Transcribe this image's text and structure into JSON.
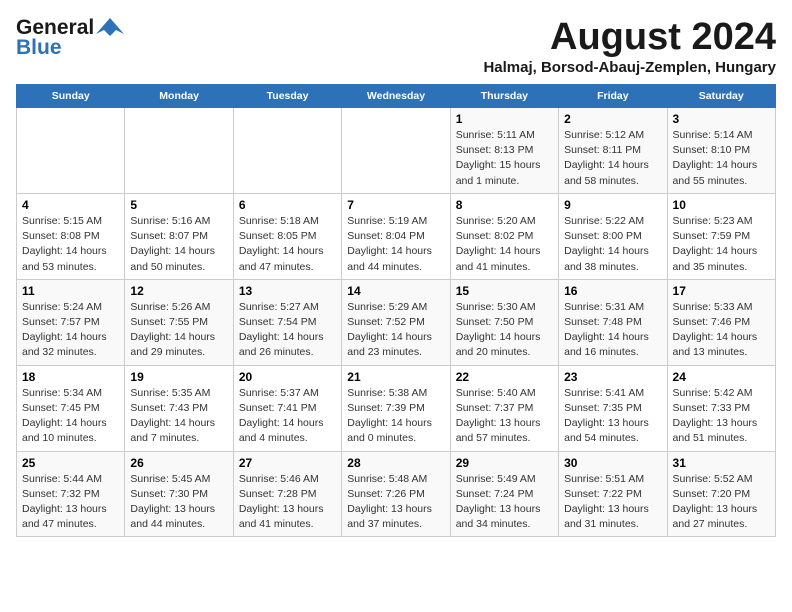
{
  "header": {
    "logo": {
      "general": "General",
      "blue": "Blue"
    },
    "month": "August 2024",
    "location": "Halmaj, Borsod-Abauj-Zemplen, Hungary"
  },
  "weekdays": [
    "Sunday",
    "Monday",
    "Tuesday",
    "Wednesday",
    "Thursday",
    "Friday",
    "Saturday"
  ],
  "weeks": [
    [
      {
        "day": "",
        "info": ""
      },
      {
        "day": "",
        "info": ""
      },
      {
        "day": "",
        "info": ""
      },
      {
        "day": "",
        "info": ""
      },
      {
        "day": "1",
        "info": "Sunrise: 5:11 AM\nSunset: 8:13 PM\nDaylight: 15 hours\nand 1 minute."
      },
      {
        "day": "2",
        "info": "Sunrise: 5:12 AM\nSunset: 8:11 PM\nDaylight: 14 hours\nand 58 minutes."
      },
      {
        "day": "3",
        "info": "Sunrise: 5:14 AM\nSunset: 8:10 PM\nDaylight: 14 hours\nand 55 minutes."
      }
    ],
    [
      {
        "day": "4",
        "info": "Sunrise: 5:15 AM\nSunset: 8:08 PM\nDaylight: 14 hours\nand 53 minutes."
      },
      {
        "day": "5",
        "info": "Sunrise: 5:16 AM\nSunset: 8:07 PM\nDaylight: 14 hours\nand 50 minutes."
      },
      {
        "day": "6",
        "info": "Sunrise: 5:18 AM\nSunset: 8:05 PM\nDaylight: 14 hours\nand 47 minutes."
      },
      {
        "day": "7",
        "info": "Sunrise: 5:19 AM\nSunset: 8:04 PM\nDaylight: 14 hours\nand 44 minutes."
      },
      {
        "day": "8",
        "info": "Sunrise: 5:20 AM\nSunset: 8:02 PM\nDaylight: 14 hours\nand 41 minutes."
      },
      {
        "day": "9",
        "info": "Sunrise: 5:22 AM\nSunset: 8:00 PM\nDaylight: 14 hours\nand 38 minutes."
      },
      {
        "day": "10",
        "info": "Sunrise: 5:23 AM\nSunset: 7:59 PM\nDaylight: 14 hours\nand 35 minutes."
      }
    ],
    [
      {
        "day": "11",
        "info": "Sunrise: 5:24 AM\nSunset: 7:57 PM\nDaylight: 14 hours\nand 32 minutes."
      },
      {
        "day": "12",
        "info": "Sunrise: 5:26 AM\nSunset: 7:55 PM\nDaylight: 14 hours\nand 29 minutes."
      },
      {
        "day": "13",
        "info": "Sunrise: 5:27 AM\nSunset: 7:54 PM\nDaylight: 14 hours\nand 26 minutes."
      },
      {
        "day": "14",
        "info": "Sunrise: 5:29 AM\nSunset: 7:52 PM\nDaylight: 14 hours\nand 23 minutes."
      },
      {
        "day": "15",
        "info": "Sunrise: 5:30 AM\nSunset: 7:50 PM\nDaylight: 14 hours\nand 20 minutes."
      },
      {
        "day": "16",
        "info": "Sunrise: 5:31 AM\nSunset: 7:48 PM\nDaylight: 14 hours\nand 16 minutes."
      },
      {
        "day": "17",
        "info": "Sunrise: 5:33 AM\nSunset: 7:46 PM\nDaylight: 14 hours\nand 13 minutes."
      }
    ],
    [
      {
        "day": "18",
        "info": "Sunrise: 5:34 AM\nSunset: 7:45 PM\nDaylight: 14 hours\nand 10 minutes."
      },
      {
        "day": "19",
        "info": "Sunrise: 5:35 AM\nSunset: 7:43 PM\nDaylight: 14 hours\nand 7 minutes."
      },
      {
        "day": "20",
        "info": "Sunrise: 5:37 AM\nSunset: 7:41 PM\nDaylight: 14 hours\nand 4 minutes."
      },
      {
        "day": "21",
        "info": "Sunrise: 5:38 AM\nSunset: 7:39 PM\nDaylight: 14 hours\nand 0 minutes."
      },
      {
        "day": "22",
        "info": "Sunrise: 5:40 AM\nSunset: 7:37 PM\nDaylight: 13 hours\nand 57 minutes."
      },
      {
        "day": "23",
        "info": "Sunrise: 5:41 AM\nSunset: 7:35 PM\nDaylight: 13 hours\nand 54 minutes."
      },
      {
        "day": "24",
        "info": "Sunrise: 5:42 AM\nSunset: 7:33 PM\nDaylight: 13 hours\nand 51 minutes."
      }
    ],
    [
      {
        "day": "25",
        "info": "Sunrise: 5:44 AM\nSunset: 7:32 PM\nDaylight: 13 hours\nand 47 minutes."
      },
      {
        "day": "26",
        "info": "Sunrise: 5:45 AM\nSunset: 7:30 PM\nDaylight: 13 hours\nand 44 minutes."
      },
      {
        "day": "27",
        "info": "Sunrise: 5:46 AM\nSunset: 7:28 PM\nDaylight: 13 hours\nand 41 minutes."
      },
      {
        "day": "28",
        "info": "Sunrise: 5:48 AM\nSunset: 7:26 PM\nDaylight: 13 hours\nand 37 minutes."
      },
      {
        "day": "29",
        "info": "Sunrise: 5:49 AM\nSunset: 7:24 PM\nDaylight: 13 hours\nand 34 minutes."
      },
      {
        "day": "30",
        "info": "Sunrise: 5:51 AM\nSunset: 7:22 PM\nDaylight: 13 hours\nand 31 minutes."
      },
      {
        "day": "31",
        "info": "Sunrise: 5:52 AM\nSunset: 7:20 PM\nDaylight: 13 hours\nand 27 minutes."
      }
    ]
  ]
}
